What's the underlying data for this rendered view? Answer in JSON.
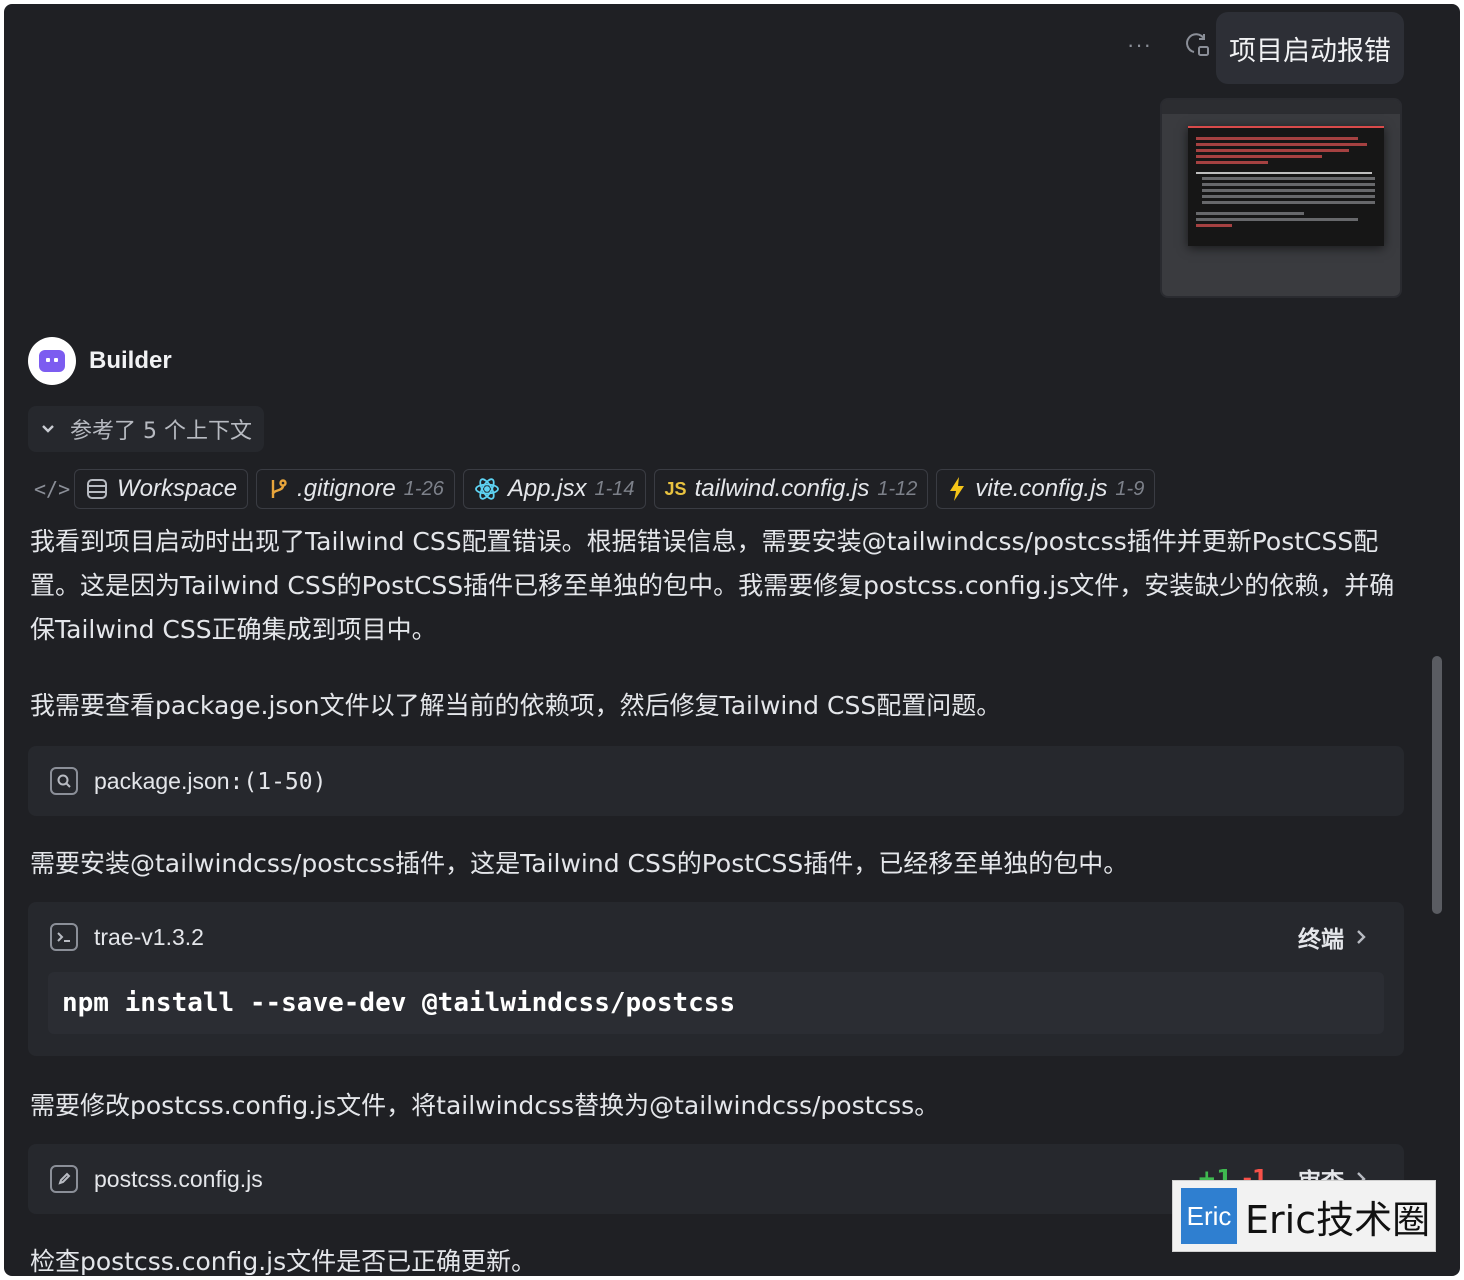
{
  "user_message": {
    "text": "项目启动报错",
    "more_icon": "ellipsis-icon",
    "retry_icon": "retry-icon"
  },
  "builder": {
    "name": "Builder"
  },
  "context": {
    "toggle_label": "参考了 5 个上下文",
    "chips": [
      {
        "name": "Workspace",
        "range": "",
        "icon": "database-icon"
      },
      {
        "name": ".gitignore",
        "range": "1-26",
        "icon": "git-branch-icon"
      },
      {
        "name": "App.jsx",
        "range": "1-14",
        "icon": "react-icon"
      },
      {
        "name": "tailwind.config.js",
        "range": "1-12",
        "icon": "js-icon"
      },
      {
        "name": "vite.config.js",
        "range": "1-9",
        "icon": "vite-icon"
      }
    ]
  },
  "paragraphs": {
    "p1": "我看到项目启动时出现了Tailwind CSS配置错误。根据错误信息，需要安装@tailwindcss/postcss插件并更新PostCSS配置。这是因为Tailwind CSS的PostCSS插件已移至单独的包中。我需要修复postcss.config.js文件，安装缺少的依赖，并确保Tailwind CSS正确集成到项目中。",
    "p2": "我需要查看package.json文件以了解当前的依赖项，然后修复Tailwind CSS配置问题。",
    "p3": "需要安装@tailwindcss/postcss插件，这是Tailwind CSS的PostCSS插件，已经移至单独的包中。",
    "p4": "需要修改postcss.config.js文件，将tailwindcss替换为@tailwindcss/postcss。",
    "p5": "检查postcss.config.js文件是否已正确更新。"
  },
  "search_card": {
    "file": "package.json",
    "range": ":(1-50)"
  },
  "terminal_card": {
    "title": "trae-v1.3.2",
    "action": "终端",
    "command": "npm install --save-dev @tailwindcss/postcss"
  },
  "edit_card": {
    "file": "postcss.config.js",
    "added": "+1",
    "removed": "-1",
    "action": "审查"
  },
  "watermark": {
    "logo": "Eric",
    "text": "Eric技术圈"
  },
  "colors": {
    "background": "#1f2024",
    "card": "#26282d",
    "accent_add": "#3fb950",
    "accent_del": "#f85149"
  }
}
